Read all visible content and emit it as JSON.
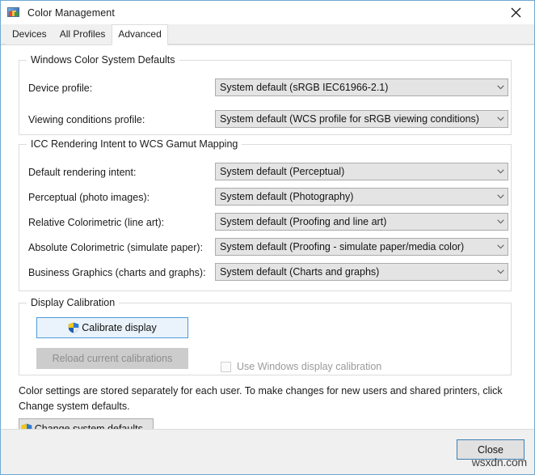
{
  "window": {
    "title": "Color Management",
    "icon": "color-management-icon",
    "close_icon": "close-icon",
    "border_color": "#6ea9d4"
  },
  "tabs": [
    {
      "label": "Devices",
      "active": false
    },
    {
      "label": "All Profiles",
      "active": false
    },
    {
      "label": "Advanced",
      "active": true
    }
  ],
  "groups": {
    "wcs_defaults": {
      "title": "Windows Color System Defaults",
      "rows": [
        {
          "label": "Device profile:",
          "value": "System default (sRGB IEC61966-2.1)"
        },
        {
          "label": "Viewing conditions profile:",
          "value": "System default (WCS profile for sRGB viewing conditions)"
        }
      ]
    },
    "icc_mapping": {
      "title": "ICC Rendering Intent to WCS Gamut Mapping",
      "rows": [
        {
          "label": "Default rendering intent:",
          "value": "System default (Perceptual)"
        },
        {
          "label": "Perceptual (photo images):",
          "value": "System default (Photography)"
        },
        {
          "label": "Relative Colorimetric (line art):",
          "value": "System default (Proofing and line art)"
        },
        {
          "label": "Absolute Colorimetric (simulate paper):",
          "value": "System default (Proofing - simulate paper/media color)"
        },
        {
          "label": "Business Graphics (charts and graphs):",
          "value": "System default (Charts and graphs)"
        }
      ]
    },
    "display_calibration": {
      "title": "Display Calibration",
      "calibrate_button": "Calibrate display",
      "reload_button": "Reload current calibrations",
      "use_windows_calibration_label": "Use Windows display calibration",
      "use_windows_calibration_checked": false
    }
  },
  "note": "Color settings are stored separately for each user. To make changes for new users and shared printers, click Change system defaults.",
  "change_defaults_button": "Change system defaults...",
  "footer": {
    "close_button": "Close"
  },
  "watermark": "wsxdn.com",
  "icons": {
    "chevron_down": "chevron-down-icon",
    "shield": "uac-shield-icon"
  }
}
